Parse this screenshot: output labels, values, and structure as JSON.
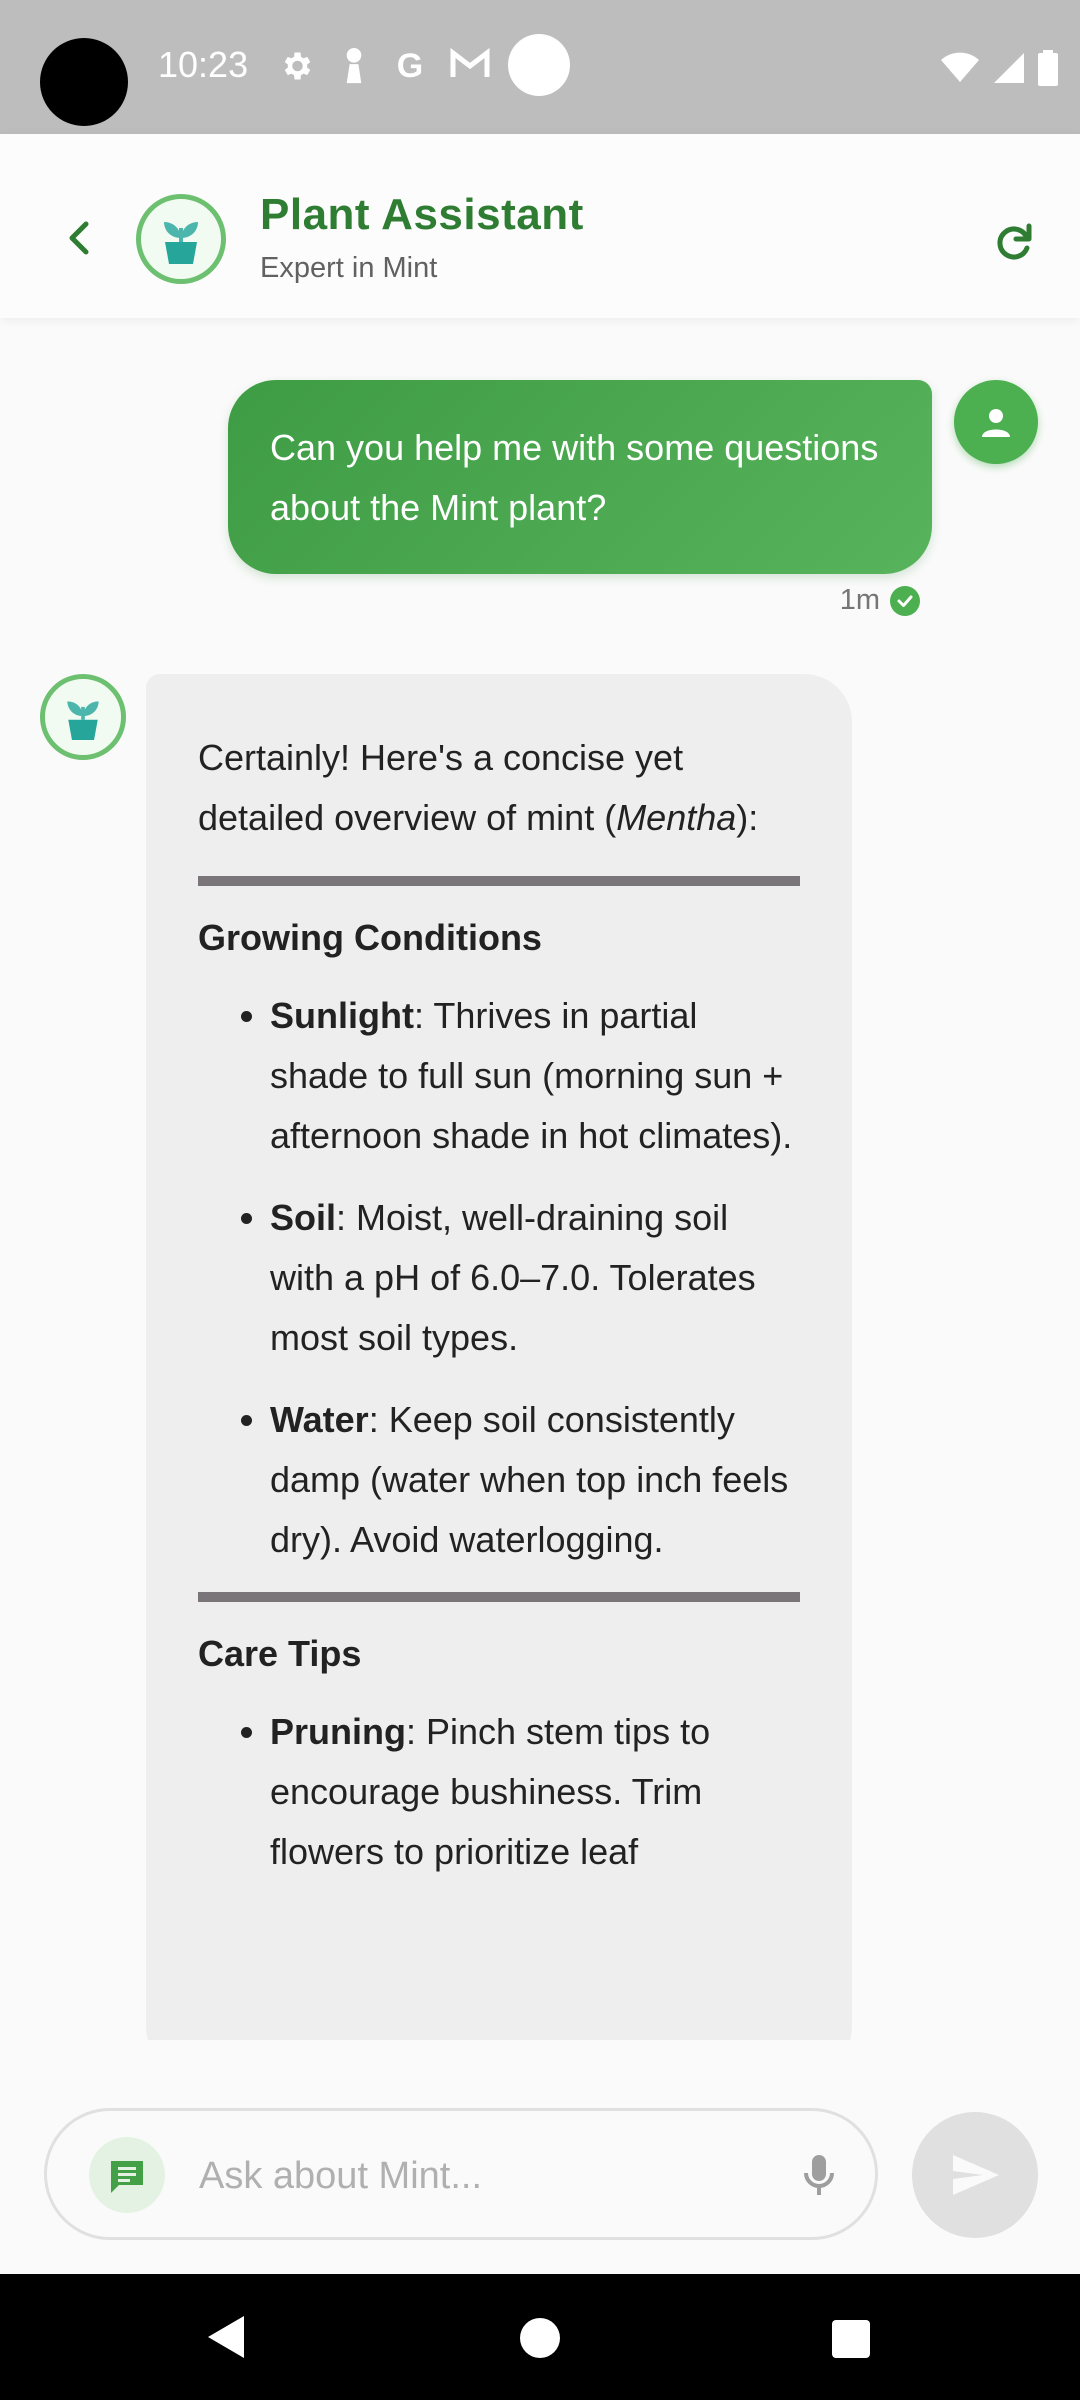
{
  "status_bar": {
    "time": "10:23"
  },
  "header": {
    "title": "Plant Assistant",
    "subtitle": "Expert in Mint",
    "icons": {
      "back": "chevron-left-icon",
      "avatar": "plant-pot-icon",
      "refresh": "refresh-icon"
    },
    "accent_color": "#2e7d32"
  },
  "messages": {
    "user": {
      "text": "Can you help me with some questions about the Mint plant?",
      "time": "1m",
      "status_icon": "check-circle-icon"
    },
    "bot": {
      "intro_pre": "Certainly! Here's a concise yet detailed overview of mint (",
      "intro_italic": "Mentha",
      "intro_post": "):",
      "sections": [
        {
          "heading": "Growing Conditions",
          "items": [
            {
              "term": "Sunlight",
              "text": ": Thrives in partial shade to full sun (morning sun + afternoon shade in hot climates)."
            },
            {
              "term": "Soil",
              "text": ": Moist, well-draining soil with a pH of 6.0–7.0. Tolerates most soil types."
            },
            {
              "term": "Water",
              "text": ": Keep soil consistently damp (water when top inch feels dry). Avoid waterlogging."
            }
          ]
        },
        {
          "heading": "Care Tips",
          "items": [
            {
              "term": "Pruning",
              "text": ": Pinch stem tips to encourage bushiness. Trim flowers to prioritize leaf"
            }
          ]
        }
      ]
    }
  },
  "input": {
    "placeholder": "Ask about Mint...",
    "icons": {
      "chat": "chat-icon",
      "mic": "mic-icon",
      "send": "send-icon"
    }
  },
  "nav_bar": {
    "icons": [
      "back-triangle-icon",
      "home-circle-icon",
      "recents-square-icon"
    ]
  }
}
